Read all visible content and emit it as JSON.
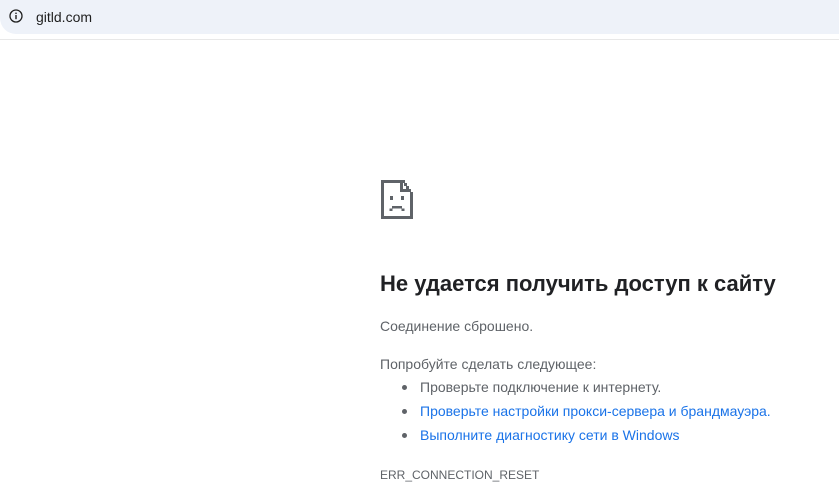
{
  "address_bar": {
    "icon": "info-icon",
    "url": "gitld.com"
  },
  "error": {
    "icon": "sad-page-icon",
    "title": "Не удается получить доступ к сайту",
    "summary": "Соединение сброшено.",
    "suggestions_heading": "Попробуйте сделать следующее:",
    "suggestions": [
      {
        "label": "Проверьте подключение к интернету.",
        "is_link": false
      },
      {
        "label": "Проверьте настройки прокси-сервера и брандмауэра.",
        "is_link": true
      },
      {
        "label": "Выполните диагностику сети в Windows",
        "is_link": true
      }
    ],
    "code": "ERR_CONNECTION_RESET"
  },
  "colors": {
    "address_bar_bg": "#eef2f9",
    "title": "#202124",
    "body_text": "#5f6368",
    "link": "#1a73e8"
  }
}
